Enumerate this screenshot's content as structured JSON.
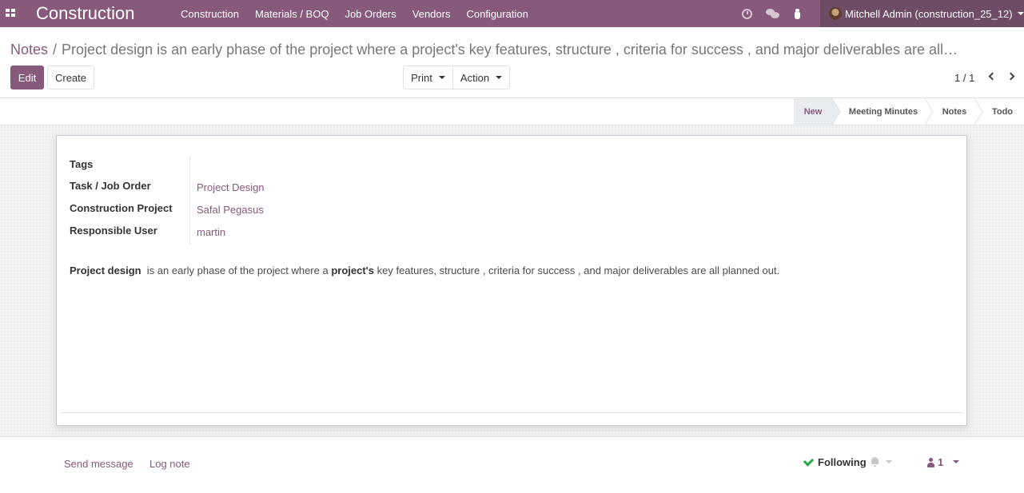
{
  "navbar": {
    "app_name": "Construction",
    "menu": [
      "Construction",
      "Materials / BOQ",
      "Job Orders",
      "Vendors",
      "Configuration"
    ],
    "user": "Mitchell Admin (construction_25_12)",
    "icons": [
      "apps-icon",
      "clock-icon",
      "chat-icon",
      "bug-icon"
    ]
  },
  "breadcrumb": {
    "parent": "Notes",
    "separator": "/",
    "current": "Project design  is an early phase of the project where a project's key features, structure , criteria for success , and major deliverables are all planned out."
  },
  "buttons": {
    "edit": "Edit",
    "create": "Create",
    "print": "Print",
    "action": "Action"
  },
  "pager": {
    "value": "1 / 1"
  },
  "stages": [
    {
      "label": "New",
      "active": true
    },
    {
      "label": "Meeting Minutes",
      "active": false
    },
    {
      "label": "Notes",
      "active": false
    },
    {
      "label": "Todo",
      "active": false
    }
  ],
  "form": {
    "tags_label": "Tags",
    "task_label": "Task / Job Order",
    "task_value": "Project Design",
    "project_label": "Construction Project",
    "project_value": "Safal Pegasus",
    "user_label": "Responsible User",
    "user_value": "martin",
    "note": {
      "part1_bold": "Project design",
      "part2": "  is an early phase of the project where a ",
      "part3_bold": "project's",
      "part4": " key features, structure , criteria for success , and major deliverables are all planned out."
    }
  },
  "chatter": {
    "send_message": "Send message",
    "log_note": "Log note",
    "following": "Following",
    "followers_count": "1"
  },
  "colors": {
    "brand": "#875a7b",
    "brand_dark": "#6f4c66",
    "success": "#28a745"
  }
}
